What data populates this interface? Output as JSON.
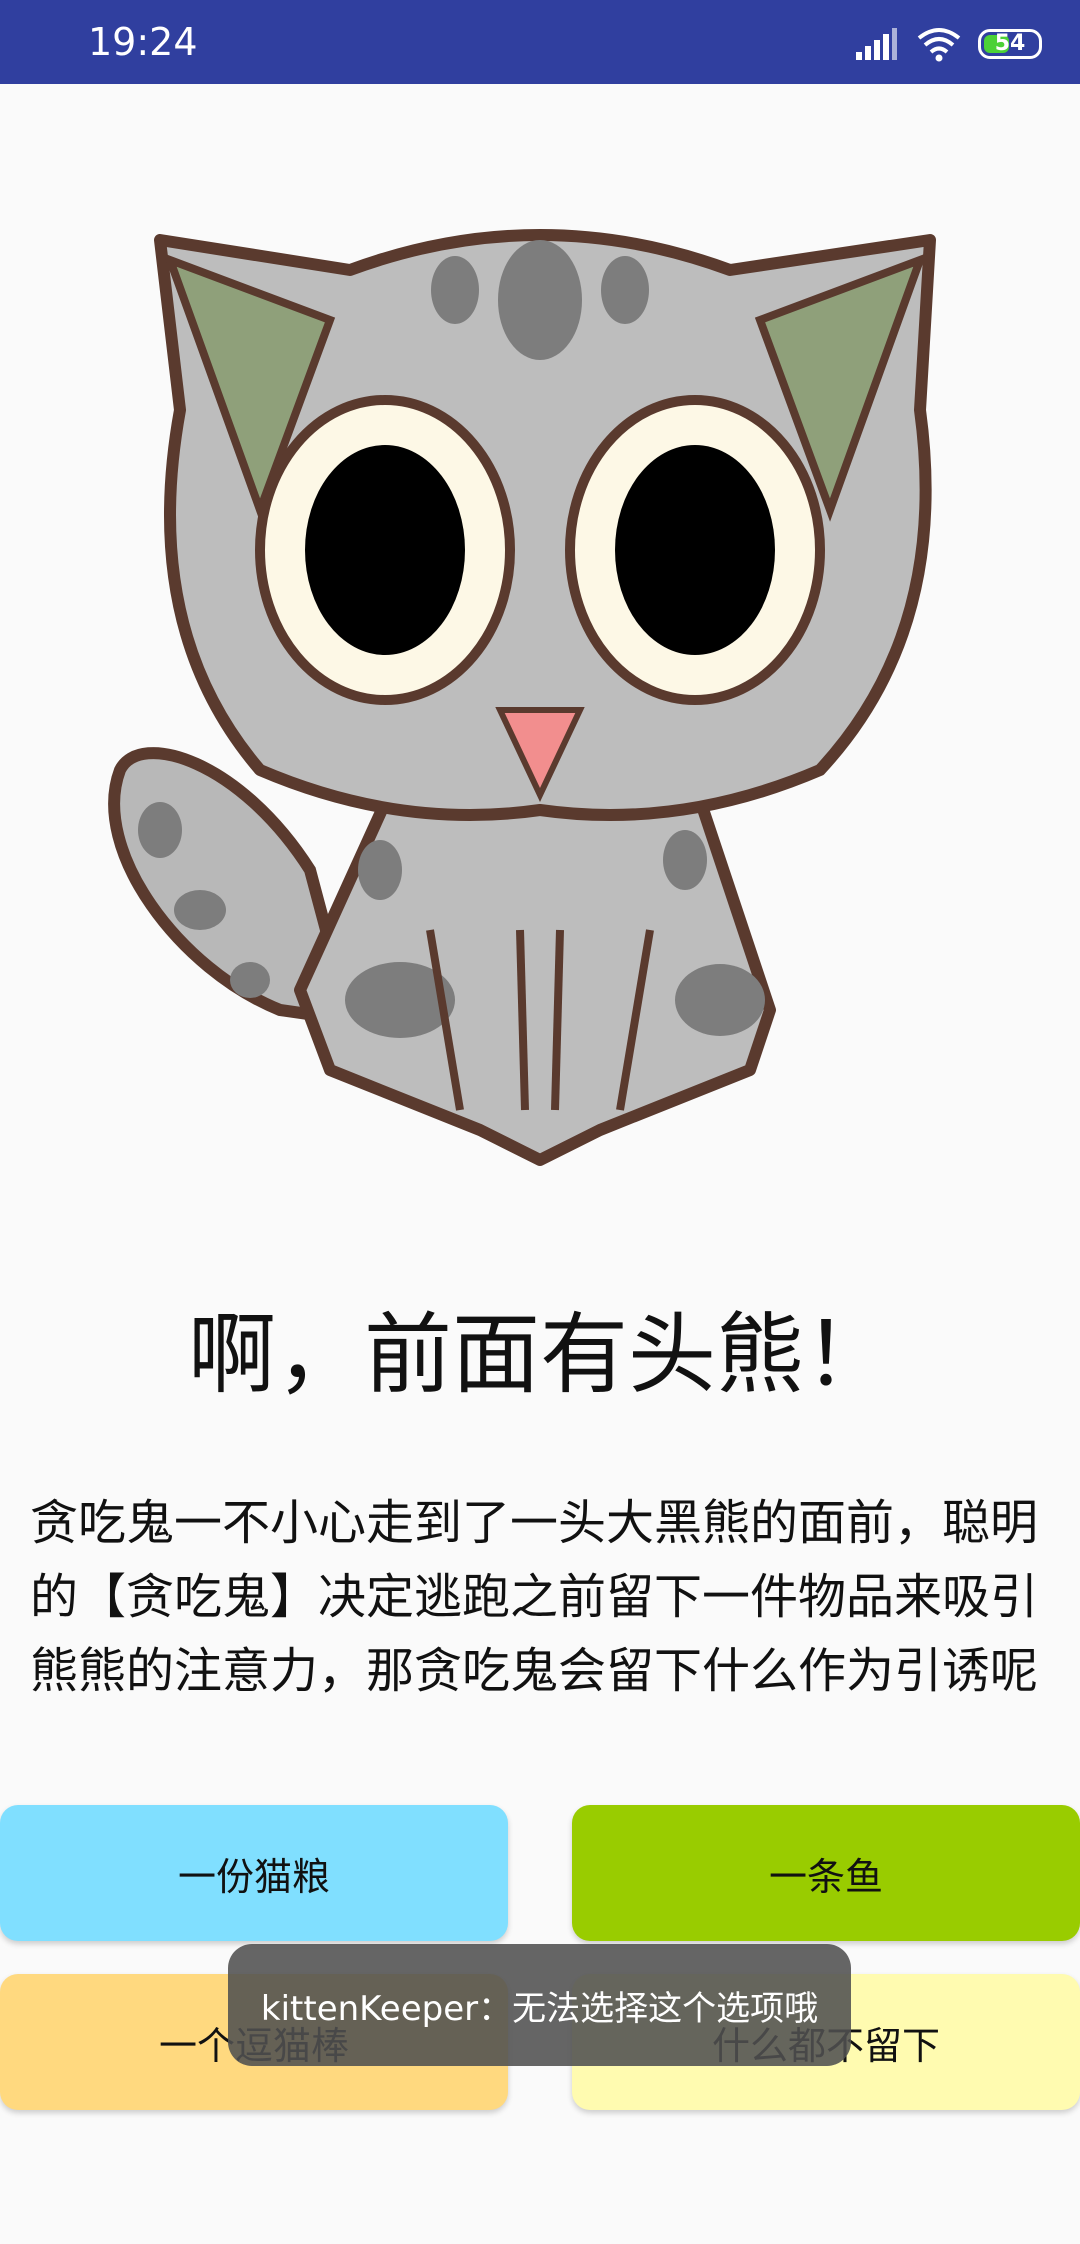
{
  "status_bar": {
    "time": "19:24",
    "battery_level": "54",
    "battery_fraction": 0.54,
    "icons": [
      "signal-icon",
      "wifi-icon",
      "battery-icon"
    ]
  },
  "story": {
    "title": "啊，前面有头熊！",
    "body": "贪吃鬼一不小心走到了一头大黑熊的面前，聪明的【贪吃鬼】决定逃跑之前留下一件物品来吸引熊熊的注意力，那贪吃鬼会留下什么作为引诱呢"
  },
  "choices": [
    {
      "label": "一份猫粮",
      "color": "#80dfff"
    },
    {
      "label": "一条鱼",
      "color": "#99cc00"
    },
    {
      "label": "一个逗猫棒",
      "color": "#ffd97f"
    },
    {
      "label": "什么都不留下",
      "color": "#fffbb0"
    }
  ],
  "toast": {
    "message": "kittenKeeper：无法选择这个选项哦"
  },
  "colors": {
    "status_bar": "#303f9f",
    "background": "#fafafa"
  }
}
